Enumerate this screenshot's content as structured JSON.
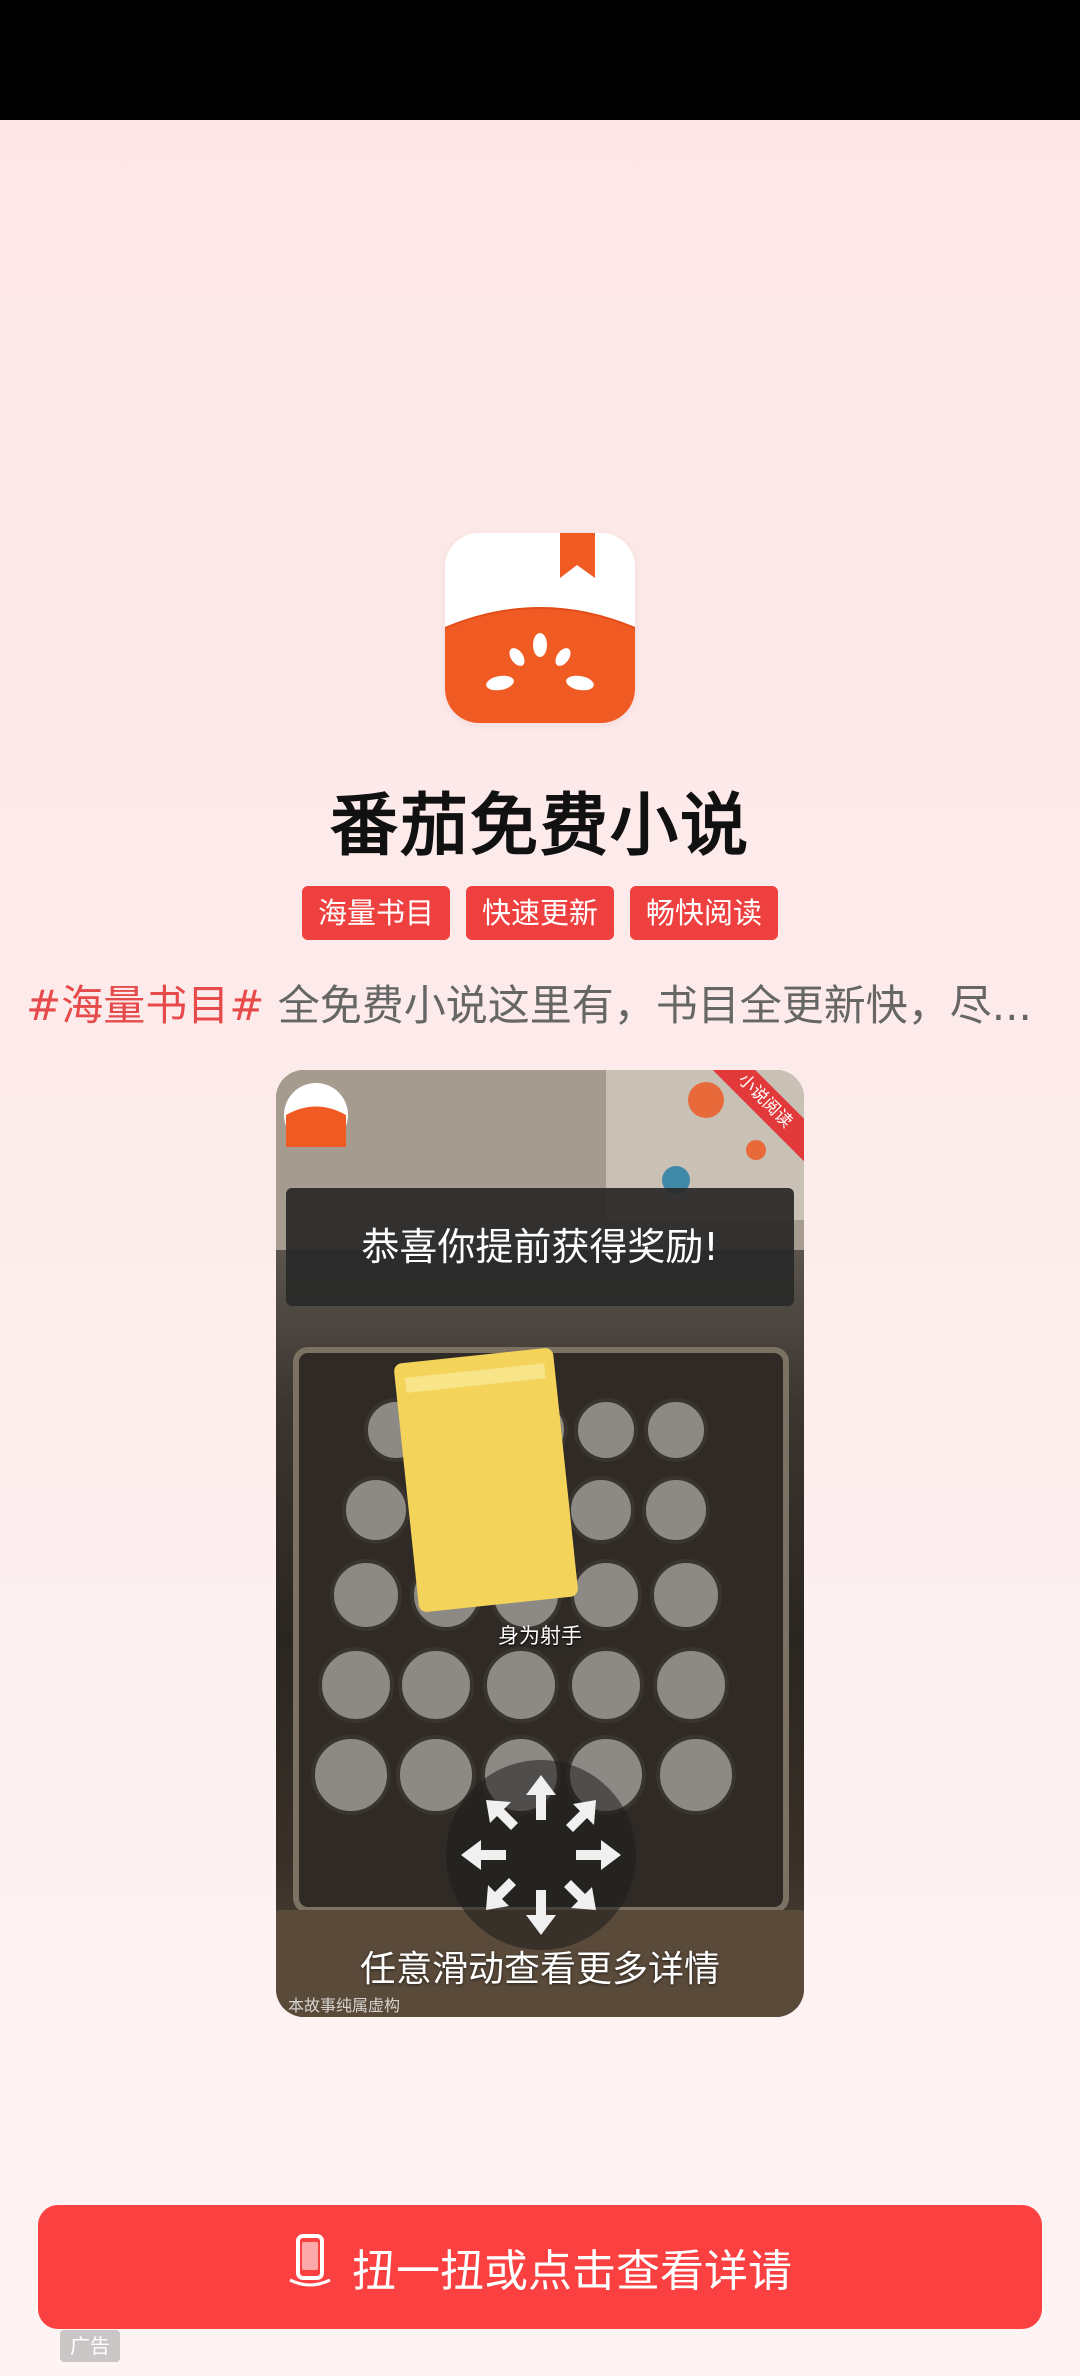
{
  "app": {
    "name": "番茄免费小说",
    "tags": [
      "海量书目",
      "快速更新",
      "畅快阅读"
    ],
    "hashtag": "#海量书目#",
    "description": "全免费小说这里有，书目全更新快，尽..."
  },
  "video": {
    "toast": "恭喜你提前获得奖励!",
    "caption": "身为射手",
    "swipe_hint": "任意滑动查看更多详情",
    "disclaimer": "本故事纯属虚构",
    "corner_ribbon": "小说阅读"
  },
  "cta": {
    "label": "扭一扭或点击查看详请"
  },
  "ad": {
    "label": "广告"
  },
  "colors": {
    "accent": "#fb4041",
    "tag": "#ef4040",
    "hashtag": "#e64a4a",
    "brand_orange": "#f05a23"
  },
  "icons": [
    "tomato-logo-icon",
    "bookmark-icon",
    "swipe-arrows-icon",
    "phone-icon"
  ]
}
